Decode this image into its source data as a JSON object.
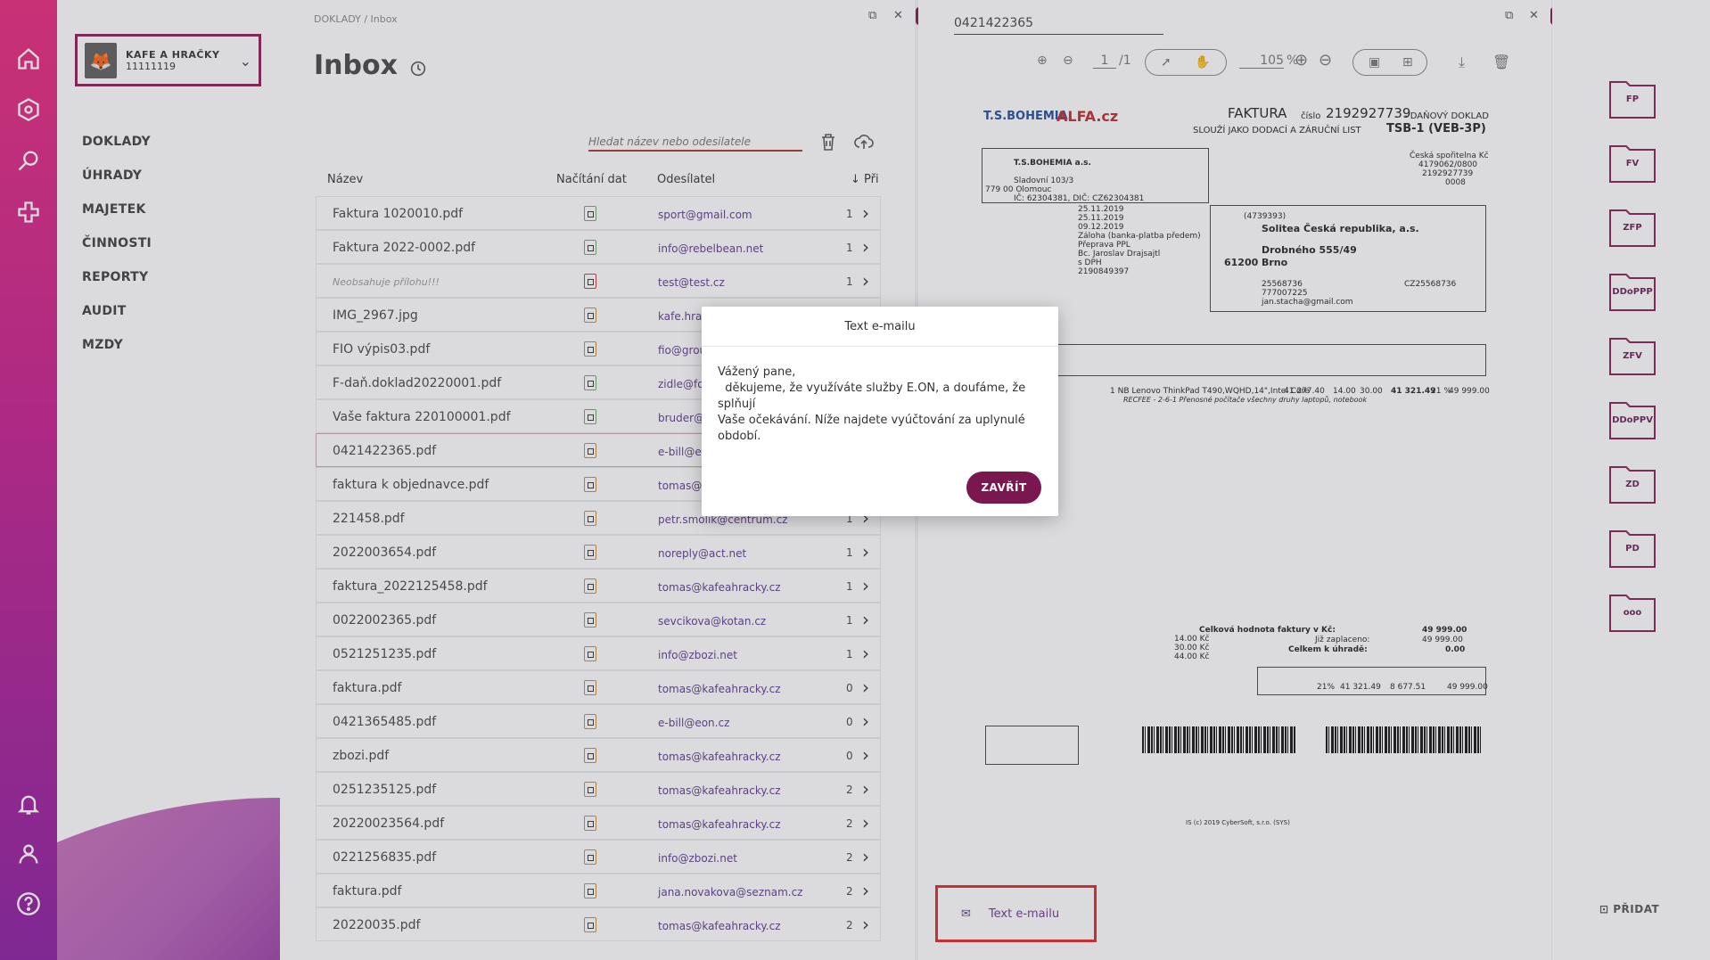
{
  "company": {
    "name": "KAFE A HRAČKY",
    "id": "11111119"
  },
  "nav": [
    "DOKLADY",
    "ÚHRADY",
    "MAJETEK",
    "ČINNOSTI",
    "REPORTY",
    "AUDIT",
    "MZDY"
  ],
  "breadcrumb": "DOKLADY / Inbox",
  "page_title": "Inbox",
  "search_placeholder": "Hledat název nebo odesilatele",
  "table_headers": {
    "name": "Název",
    "loading": "Načítání dat",
    "sender": "Odesílatel",
    "count": "↓ Při"
  },
  "rows": [
    {
      "name": "Faktura 1020010.pdf",
      "icon": "green",
      "sender": "sport@gmail.com",
      "count": "1"
    },
    {
      "name": "Faktura 2022-0002.pdf",
      "icon": "green",
      "sender": "info@rebelbean.net",
      "count": "1"
    },
    {
      "name": "Neobsahuje přílohu!!!",
      "icon": "red",
      "sender": "test@test.cz",
      "count": "1",
      "italic": true
    },
    {
      "name": "IMG_2967.jpg",
      "icon": "orange",
      "sender": "kafe.hrac",
      "count": ""
    },
    {
      "name": "FIO výpis03.pdf",
      "icon": "orange",
      "sender": "fio@grou",
      "count": ""
    },
    {
      "name": "F-daň.doklad20220001.pdf",
      "icon": "green",
      "sender": "zidle@fo",
      "count": ""
    },
    {
      "name": "Vaše faktura 220100001.pdf",
      "icon": "green",
      "sender": "bruder@",
      "count": ""
    },
    {
      "name": "0421422365.pdf",
      "icon": "orange",
      "sender": "e-bill@e",
      "count": "",
      "selected": true
    },
    {
      "name": "faktura k objednavce.pdf",
      "icon": "orange",
      "sender": "tomas@k",
      "count": ""
    },
    {
      "name": "221458.pdf",
      "icon": "orange",
      "sender": "petr.smolik@centrum.cz",
      "count": "1"
    },
    {
      "name": "2022003654.pdf",
      "icon": "orange",
      "sender": "noreply@act.net",
      "count": "1"
    },
    {
      "name": "faktura_2022125458.pdf",
      "icon": "orange",
      "sender": "tomas@kafeahracky.cz",
      "count": "1"
    },
    {
      "name": "0022002365.pdf",
      "icon": "orange",
      "sender": "sevcikova@kotan.cz",
      "count": "1"
    },
    {
      "name": "0521251235.pdf",
      "icon": "orange",
      "sender": "info@zbozi.net",
      "count": "1"
    },
    {
      "name": "faktura.pdf",
      "icon": "orange",
      "sender": "tomas@kafeahracky.cz",
      "count": "0"
    },
    {
      "name": "0421365485.pdf",
      "icon": "orange",
      "sender": "e-bill@eon.cz",
      "count": "0"
    },
    {
      "name": "zbozi.pdf",
      "icon": "orange",
      "sender": "tomas@kafeahracky.cz",
      "count": "0"
    },
    {
      "name": "0251235125.pdf",
      "icon": "orange",
      "sender": "tomas@kafeahracky.cz",
      "count": "2"
    },
    {
      "name": "20220023564.pdf",
      "icon": "orange",
      "sender": "tomas@kafeahracky.cz",
      "count": "2"
    },
    {
      "name": "0221256835.pdf",
      "icon": "orange",
      "sender": "info@zbozi.net",
      "count": "2"
    },
    {
      "name": "faktura.pdf",
      "icon": "orange",
      "sender": "jana.novakova@seznam.cz",
      "count": "2"
    },
    {
      "name": "20220035.pdf",
      "icon": "orange",
      "sender": "tomas@kafeahracky.cz",
      "count": "2"
    }
  ],
  "preview": {
    "doc_number": "0421422365",
    "page": "1",
    "pages": "/1",
    "zoom": "105",
    "zoom_unit": "%",
    "email_button": "Text e-mailu"
  },
  "invoice": {
    "brand1": "T.S.BOHEMIA",
    "brand2": "ALFA.cz",
    "heading": "FAKTURA",
    "number_label": "číslo",
    "number": "2192927739",
    "tax": "- DAŇOVÝ DOKLAD",
    "subtitle": "SLOUŽÍ JAKO DODACÍ A ZÁRUČNÍ LIST",
    "code": "TSB-1 (VEB-3P)",
    "supplier": "T.S.BOHEMIA a.s.",
    "street": "Sladovní 103/3",
    "city": "779 00 Olomouc",
    "ic": "IČ: 62304381, DIČ: CZ62304381",
    "bank": "Česká spořitelna Kč",
    "account": "4179062/0800",
    "vs": "2192927739",
    "ks": "0008",
    "issue_date": "25.11.2019",
    "tax_date": "25.11.2019",
    "due_date": "09.12.2019",
    "payment": "Záloha (banka-platba předem)",
    "transport": "Přeprava PPL",
    "issuer": "Bc. Jaroslav Drajsajtl",
    "invoiced": "s DPH",
    "order": "2190849397",
    "customer": "Solitea Česká republika, a.s.",
    "customer_id": "(4739393)",
    "cust_street": "Drobného 555/49",
    "cust_zip": "61200",
    "cust_city": "Brno",
    "cust_ic": "25568736",
    "cust_dic": "CZ25568736",
    "cust_tel": "777007225",
    "cust_email": "jan.stacha@gmail.com",
    "item": "1 NB Lenovo ThinkPad T490,WQHD,14\",Intel Core",
    "item_price": "41 277.40",
    "item_rp": "14.00",
    "item_ap": "30.00",
    "item_total_base": "41 321.49",
    "item_vat": "21 %",
    "item_total": "49 999.00",
    "recycle": "RECFEE - 2-6-1 Přenosné počítače všechny druhy laptopů, notebook",
    "total_label": "Celková hodnota faktury v Kč:",
    "total": "49 999.00",
    "paid_label": "Již zaplaceno:",
    "paid": "49 999.00",
    "due_label": "Celkem k úhradě:",
    "due": "0.00",
    "vat_pct": "21%",
    "vat_base": "41 321.49",
    "vat_amount": "8 677.51",
    "vat_total": "49 999.00",
    "fees_rec": "14.00 Kč",
    "fees_aut": "30.00 Kč",
    "fees_total": "44.00 Kč",
    "footer": "IS (c) 2019 CyberSoft, s.r.o. (SYS)"
  },
  "folders": [
    "FP",
    "FV",
    "ZFP",
    "DDoPPP",
    "ZFV",
    "DDoPPV",
    "ZD",
    "PD",
    "ooo"
  ],
  "pridat": "PŘIDAT",
  "modal": {
    "title": "Text e-mailu",
    "body": "Vážený pane,\n  děkujeme, že využíváte služby E.ON, a doufáme, že splňují\nVaše očekávání. Níže najdete vyúčtování za uplynulé období.",
    "button": "ZAVŘÍT"
  },
  "colors": {
    "accent": "#7a1750",
    "rail_top": "#e8267a",
    "rail_bottom": "#8a1aa0"
  }
}
